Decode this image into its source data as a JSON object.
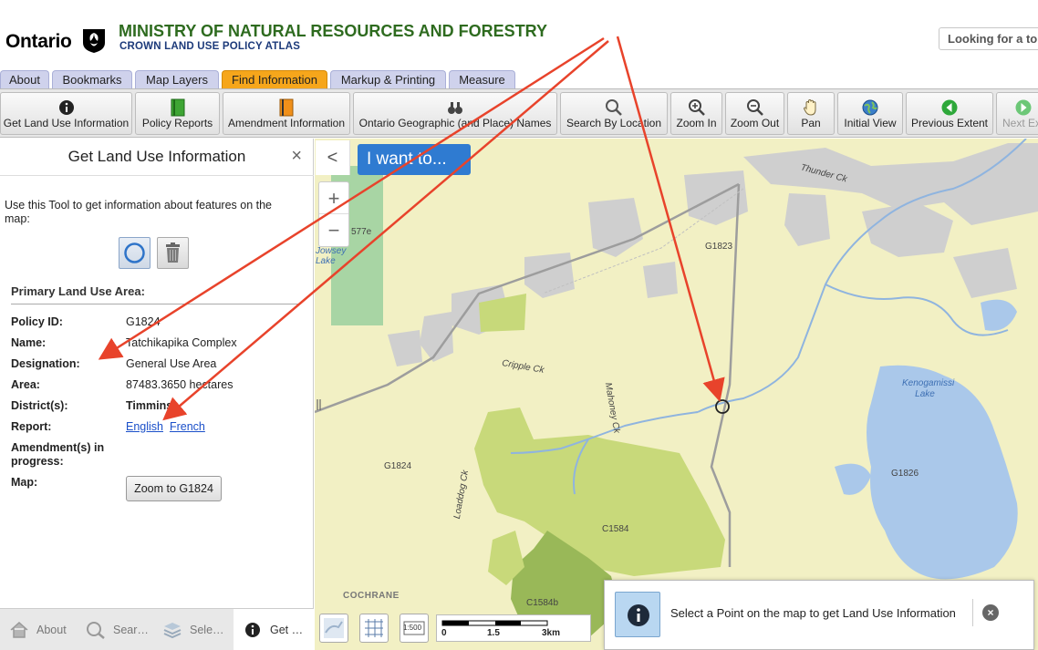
{
  "header": {
    "brand": "Ontario",
    "ministry": "MINISTRY OF NATURAL RESOURCES AND FORESTRY",
    "atlas": "CROWN LAND USE POLICY ATLAS",
    "search_placeholder": "Looking for a to"
  },
  "tabs": [
    {
      "label": "About",
      "active": false
    },
    {
      "label": "Bookmarks",
      "active": false
    },
    {
      "label": "Map Layers",
      "active": false
    },
    {
      "label": "Find Information",
      "active": true
    },
    {
      "label": "Markup & Printing",
      "active": false
    },
    {
      "label": "Measure",
      "active": false
    }
  ],
  "toolbar": [
    {
      "label": "Get Land Use Information",
      "icon": "info-icon"
    },
    {
      "label": "Policy Reports",
      "icon": "book-icon"
    },
    {
      "label": "Amendment Information",
      "icon": "book-orange-icon"
    },
    {
      "label": "Ontario Geographic (and Place) Names",
      "icon": "binoculars-icon"
    },
    {
      "label": "Search By Location",
      "icon": "search-icon"
    },
    {
      "label": "Zoom In",
      "icon": "zoom-in-icon"
    },
    {
      "label": "Zoom Out",
      "icon": "zoom-out-icon"
    },
    {
      "label": "Pan",
      "icon": "hand-icon"
    },
    {
      "label": "Initial View",
      "icon": "globe-icon"
    },
    {
      "label": "Previous Extent",
      "icon": "back-arrow-icon"
    },
    {
      "label": "Next Extent",
      "icon": "forward-arrow-icon"
    }
  ],
  "panel": {
    "title": "Get Land Use Information",
    "close": "×",
    "description": "Use this Tool to get information about features on the map:",
    "section": "Primary Land Use Area:",
    "rows": {
      "policy_id": {
        "label": "Policy ID:",
        "value": "G1824"
      },
      "name": {
        "label": "Name:",
        "value": "Tatchikapika Complex"
      },
      "designation": {
        "label": "Designation:",
        "value": "General Use Area"
      },
      "area": {
        "label": "Area:",
        "value": "87483.3650 hectares"
      },
      "district": {
        "label": "District(s):",
        "value": "Timmins"
      },
      "report": {
        "label": "Report:",
        "english": "English",
        "french": "French"
      },
      "amendment": {
        "label": "Amendment(s) in progress:",
        "value": ""
      },
      "map": {
        "label": "Map:",
        "button": "Zoom to G1824"
      }
    }
  },
  "bottom_tabs": [
    {
      "label": "About",
      "icon": "home-icon",
      "active": false
    },
    {
      "label": "Sear…",
      "icon": "search-icon",
      "active": false
    },
    {
      "label": "Sele…",
      "icon": "layers-icon",
      "active": false
    },
    {
      "label": "Get …",
      "icon": "info-icon",
      "active": true
    }
  ],
  "map": {
    "i_want": "I want to...",
    "zoom_in": "+",
    "zoom_out": "−",
    "collapse": "<",
    "labels": {
      "g1823": "G1823",
      "g1824": "G1824",
      "g1826": "G1826",
      "c1584": "C1584",
      "c1584b": "C1584b",
      "p577e": "577e",
      "jowsey": "Jowsey Lake",
      "kenogamissi": "Kenogamissi Lake",
      "cochrane": "COCHRANE",
      "cripple": "Cripple Ck",
      "mahoney": "Mahoney Ck",
      "loaddog": "Loaddog Ck",
      "thunder": "Thunder Ck"
    },
    "scale": {
      "s0": "0",
      "s1": "1.5",
      "s2": "3km",
      "ratio": "1:500"
    },
    "info_message": "Select a Point on the map to get Land Use Information"
  },
  "colors": {
    "active_tab": "#f6a61b",
    "tab": "#cfd2ec",
    "ministry": "#2e6b1f",
    "link": "#1a4fc9",
    "annotation_arrow": "#e8432b"
  }
}
